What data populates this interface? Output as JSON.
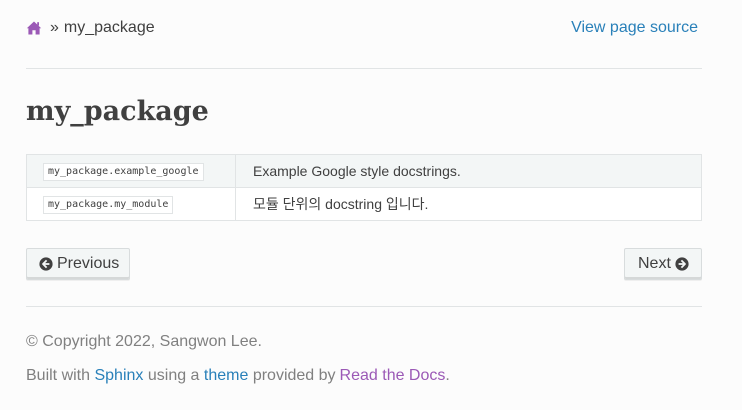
{
  "breadcrumb": {
    "home_icon": "home-icon",
    "separator": "»",
    "current": "my_package",
    "view_source": "View page source"
  },
  "page": {
    "title": "my_package"
  },
  "modules": [
    {
      "name": "my_package.example_google",
      "description": "Example Google style docstrings."
    },
    {
      "name": "my_package.my_module",
      "description": "모듈 단위의 docstring 입니다."
    }
  ],
  "nav": {
    "previous_label": "Previous",
    "previous_icon": "arrow-circle-left-icon",
    "next_label": "Next",
    "next_icon": "arrow-circle-right-icon"
  },
  "footer": {
    "copyright": "© Copyright 2022, Sangwon Lee.",
    "built_with_prefix": "Built with",
    "sphinx_link": "Sphinx",
    "using_a": "using a",
    "theme_link": "theme",
    "provided_by": "provided by",
    "rtd_link": "Read the Docs",
    "period": "."
  },
  "colors": {
    "link": "#2980b9",
    "visited_link": "#9b59b6",
    "text": "#404040",
    "muted": "#808080"
  }
}
